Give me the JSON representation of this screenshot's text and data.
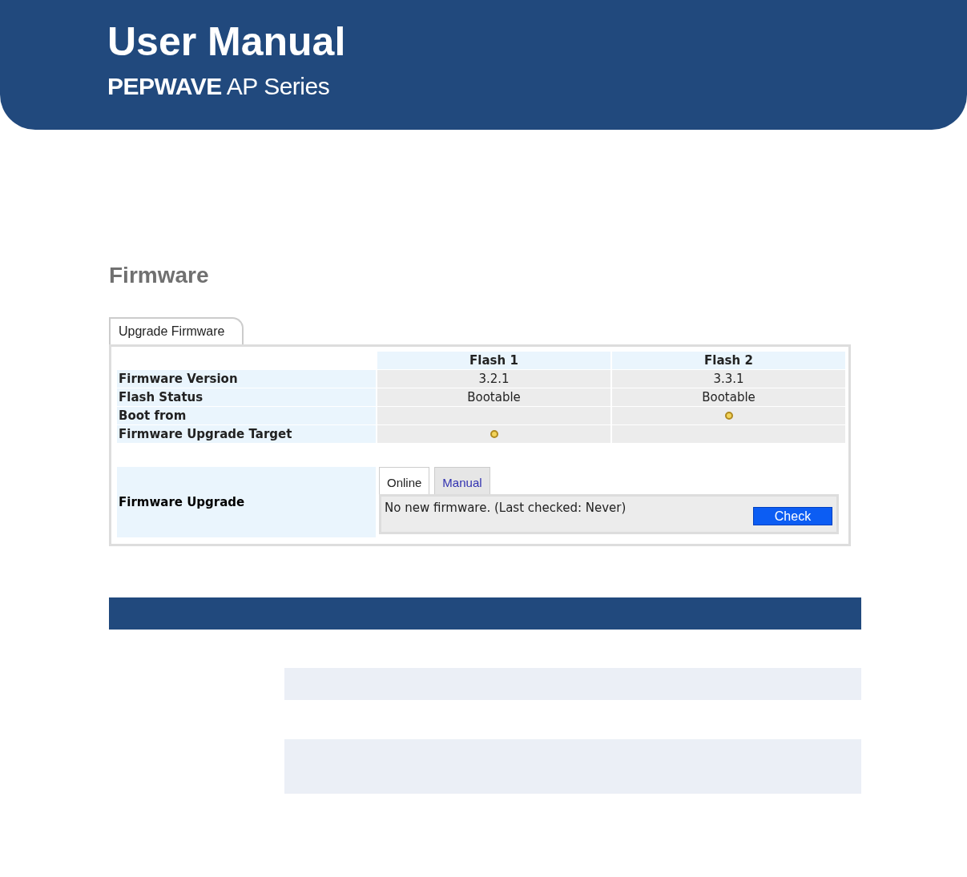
{
  "header": {
    "title": "User Manual",
    "subtitle": "**PEPWAVE** AP Series"
  },
  "section": {
    "title": "Firmware"
  },
  "tabs": [
    {
      "label": "Upgrade Firmware",
      "selected": true
    }
  ],
  "table": {
    "columns": [
      "Flash 1",
      "Flash 2"
    ],
    "rows": [
      {
        "label": "Firmware Version",
        "kind": "text",
        "cells": [
          "3.2.1",
          "3.3.1"
        ]
      },
      {
        "label": "Flash Status",
        "kind": "text",
        "cells": [
          "Bootable",
          "Bootable"
        ]
      },
      {
        "label": "Boot from",
        "kind": "radio",
        "cells": [
          {
            "selected": false
          },
          {
            "selected": true
          }
        ]
      },
      {
        "label": "Firmware Upgrade Target",
        "kind": "radio",
        "cells": [
          {
            "selected": true
          },
          {
            "selected": false
          }
        ]
      }
    ]
  },
  "upgrade": {
    "label": "Firmware Upgrade",
    "tabs": [
      {
        "label": "Online",
        "selected": true
      },
      {
        "label": "Manual",
        "selected": false
      }
    ],
    "message": "No new firmware. (Last checked: Never)",
    "button": "Check"
  }
}
